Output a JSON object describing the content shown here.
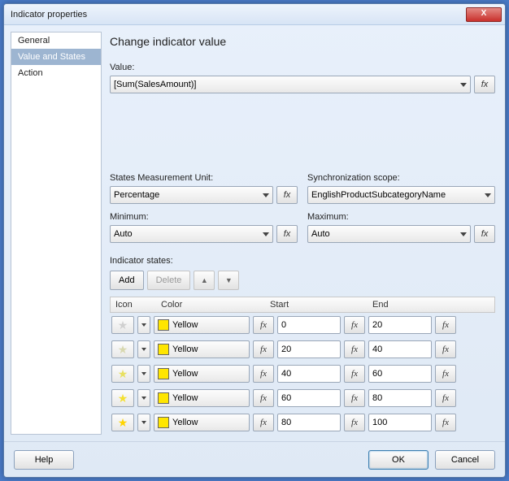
{
  "window_title": "Indicator properties",
  "sidebar": {
    "items": [
      {
        "label": "General"
      },
      {
        "label": "Value and States"
      },
      {
        "label": "Action"
      }
    ],
    "selected_index": 1
  },
  "heading": "Change indicator value",
  "value_field": {
    "label": "Value:",
    "value": "[Sum(SalesAmount)]"
  },
  "measurement": {
    "label": "States Measurement Unit:",
    "value": "Percentage"
  },
  "sync_scope": {
    "label": "Synchronization scope:",
    "value": "EnglishProductSubcategoryName"
  },
  "minimum": {
    "label": "Minimum:",
    "value": "Auto"
  },
  "maximum": {
    "label": "Maximum:",
    "value": "Auto"
  },
  "states_label": "Indicator states:",
  "buttons": {
    "add": "Add",
    "delete": "Delete"
  },
  "columns": {
    "icon": "Icon",
    "color": "Color",
    "start": "Start",
    "end": "End"
  },
  "states": [
    {
      "star_color": "#d0d0d0",
      "color_name": "Yellow",
      "swatch": "#ffe600",
      "start": "0",
      "end": "20"
    },
    {
      "star_color": "#d8d8b0",
      "color_name": "Yellow",
      "swatch": "#ffe600",
      "start": "20",
      "end": "40"
    },
    {
      "star_color": "#e8e060",
      "color_name": "Yellow",
      "swatch": "#ffe600",
      "start": "40",
      "end": "60"
    },
    {
      "star_color": "#f4e030",
      "color_name": "Yellow",
      "swatch": "#ffe600",
      "start": "60",
      "end": "80"
    },
    {
      "star_color": "#ffd400",
      "color_name": "Yellow",
      "swatch": "#ffe600",
      "start": "80",
      "end": "100"
    }
  ],
  "footer": {
    "help": "Help",
    "ok": "OK",
    "cancel": "Cancel"
  },
  "fx_label": "fx"
}
